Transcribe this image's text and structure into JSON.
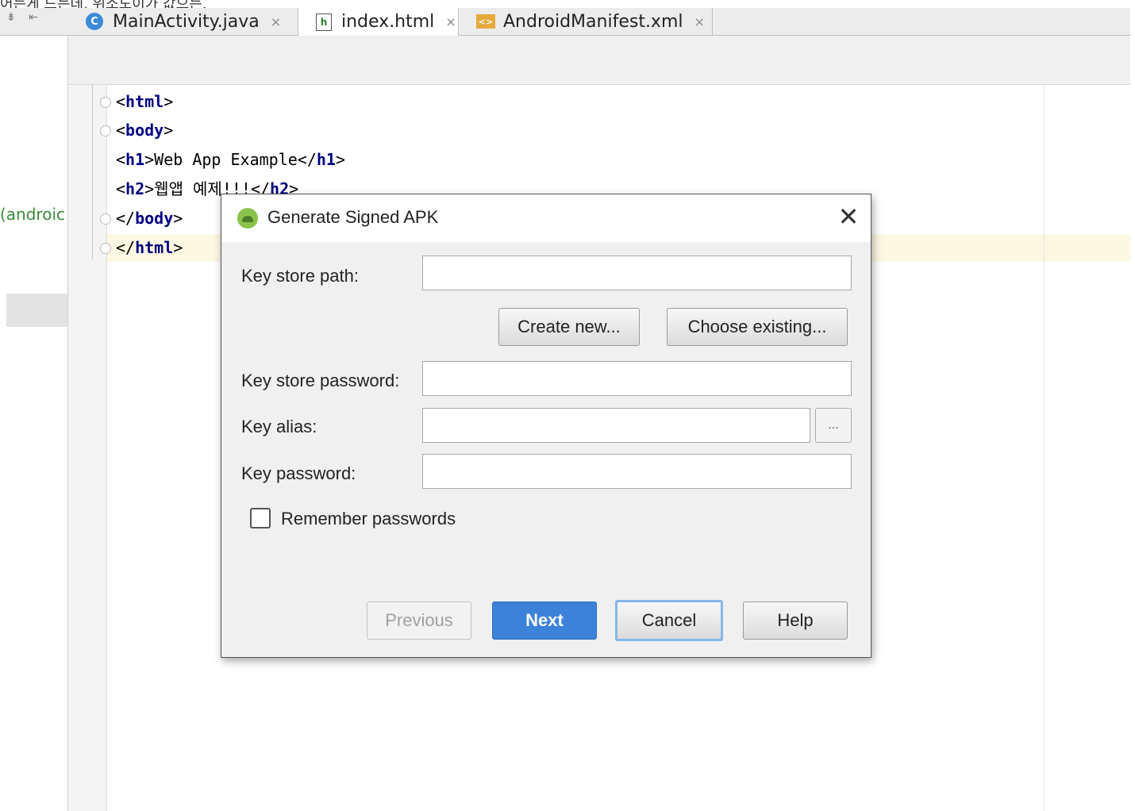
{
  "top_partial_text": "어는게 드는데, 위소도이가 값으는.",
  "editor_tabs": [
    {
      "label": "MainActivity.java",
      "icon": "java-class-icon",
      "close": "×"
    },
    {
      "label": "index.html",
      "icon": "html-file-icon",
      "close": "×"
    },
    {
      "label": "AndroidManifest.xml",
      "icon": "xml-file-icon",
      "close": "×"
    }
  ],
  "left_panel_text": "(androic",
  "code_lines": {
    "l1": {
      "open": "<",
      "tag": "html",
      "close": ">"
    },
    "l2": {
      "open": "<",
      "tag": "body",
      "close": ">"
    },
    "l3": {
      "open": "<",
      "tag": "h1",
      "mid": ">Web App Example</",
      "tag2": "h1",
      "close": ">"
    },
    "l4": {
      "open": "<",
      "tag": "h2",
      "mid": ">웹앱 예제!!!</",
      "tag2": "h2",
      "close": ">"
    },
    "l5": {
      "open": "</",
      "tag": "body",
      "close": ">"
    },
    "l6": {
      "open": "</",
      "tag": "html",
      "close": ">"
    }
  },
  "dialog": {
    "title": "Generate Signed APK",
    "close_glyph": "✕",
    "key_store_path_label": "Key store path:",
    "key_store_path_value": "",
    "create_new_label": "Create new...",
    "choose_existing_label": "Choose existing...",
    "key_store_password_label": "Key store password:",
    "key_store_password_value": "",
    "key_alias_label": "Key alias:",
    "key_alias_value": "",
    "key_alias_browse": "...",
    "key_password_label": "Key password:",
    "key_password_value": "",
    "remember_passwords_label": "Remember passwords",
    "remember_passwords_checked": false,
    "previous_label": "Previous",
    "next_label": "Next",
    "cancel_label": "Cancel",
    "help_label": "Help"
  },
  "colors": {
    "accent": "#3d82d9",
    "tag_color": "#000080",
    "current_line": "#fcf8e3"
  }
}
